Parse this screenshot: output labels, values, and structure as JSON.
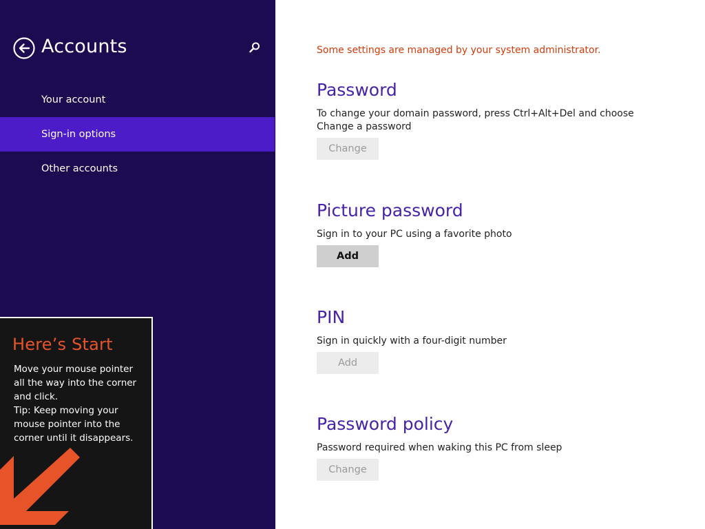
{
  "left_pane": {
    "title": "Accounts",
    "back_icon": "back-arrow-circle-icon",
    "search_icon": "search-icon",
    "nav_items": [
      {
        "label": "Your account",
        "selected": false
      },
      {
        "label": "Sign-in options",
        "selected": true
      },
      {
        "label": "Other accounts",
        "selected": false
      }
    ]
  },
  "start_tip": {
    "title": "Here’s Start",
    "lines": [
      "Move your mouse pointer",
      "all the way into the corner",
      "and click.",
      "Tip: Keep moving your",
      "mouse pointer into the",
      "corner until it disappears."
    ],
    "arrow_icon": "corner-arrow-icon"
  },
  "content": {
    "admin_notice": "Some settings are managed by your system administrator.",
    "sections": [
      {
        "heading": "Password",
        "description": "To change your domain password, press Ctrl+Alt+Del and choose Change a password",
        "button_label": "Change",
        "button_enabled": false
      },
      {
        "heading": "Picture password",
        "description": "Sign in to your PC using a favorite photo",
        "button_label": "Add",
        "button_enabled": true
      },
      {
        "heading": "PIN",
        "description": "Sign in quickly with a four-digit number",
        "button_label": "Add",
        "button_enabled": false
      },
      {
        "heading": "Password policy",
        "description": "Password required when waking this PC from sleep",
        "button_label": "Change",
        "button_enabled": false
      }
    ]
  },
  "colors": {
    "pane_background": "#1c0b50",
    "selected_item": "#4d1cc9",
    "heading": "#4623a8",
    "admin_notice": "#d23c0c",
    "tip_title": "#e8542a"
  }
}
